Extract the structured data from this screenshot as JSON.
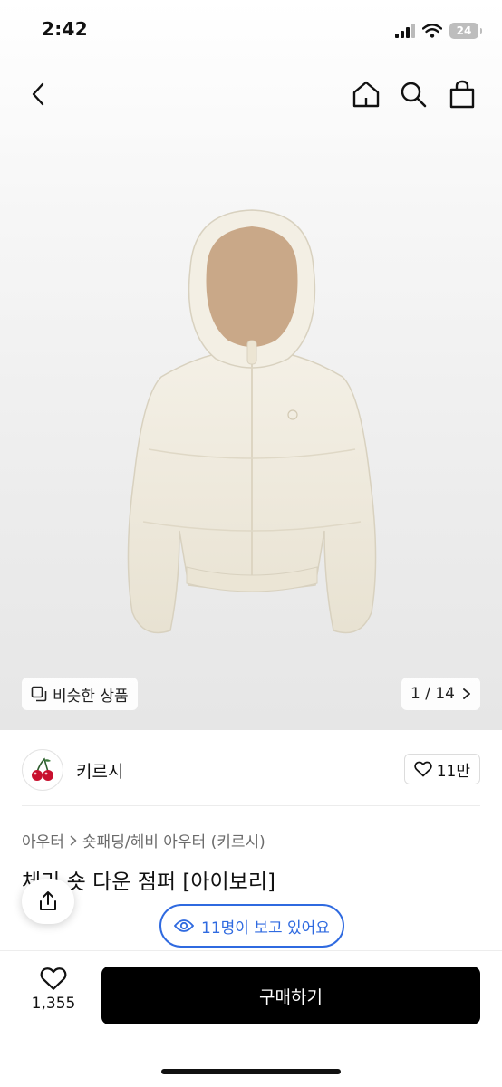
{
  "status_bar": {
    "time": "2:42",
    "battery": "24"
  },
  "nav": {
    "back_icon": "chevron-left-icon",
    "home_icon": "home-icon",
    "search_icon": "search-icon",
    "bag_icon": "shopping-bag-icon"
  },
  "gallery": {
    "similar_label": "비슷한 상품",
    "counter": "1 / 14"
  },
  "shop": {
    "name": "키르시",
    "like_count": "11만"
  },
  "breadcrumb": {
    "category": "아우터",
    "subcategory": "숏패딩/헤비 아우터 (키르시)"
  },
  "product": {
    "title": "체리 숏 다운 점퍼 [아이보리]"
  },
  "viewers": {
    "label": "11명이 보고 있어요"
  },
  "bottom": {
    "wish_count": "1,355",
    "buy_label": "구매하기"
  },
  "colors": {
    "accent_blue": "#2f6ae0",
    "buy_button": "#000000",
    "jacket": "#efeadc",
    "hood_lining": "#c9a888"
  }
}
